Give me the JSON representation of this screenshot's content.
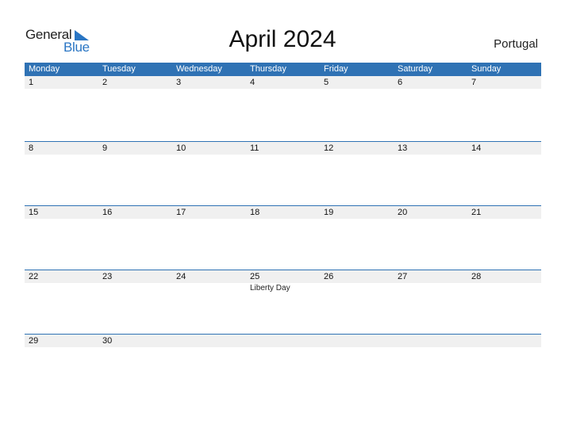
{
  "logo": {
    "word1": "General",
    "word2": "Blue",
    "icon": "triangle-flag-icon",
    "brand_color": "#2a76c4"
  },
  "title": "April 2024",
  "country": "Portugal",
  "colors": {
    "header_bg": "#2f72b4",
    "date_row_bg": "#f0f0f0"
  },
  "weekdays": [
    "Monday",
    "Tuesday",
    "Wednesday",
    "Thursday",
    "Friday",
    "Saturday",
    "Sunday"
  ],
  "weeks": [
    {
      "days": [
        "1",
        "2",
        "3",
        "4",
        "5",
        "6",
        "7"
      ],
      "events": [
        "",
        "",
        "",
        "",
        "",
        "",
        ""
      ]
    },
    {
      "days": [
        "8",
        "9",
        "10",
        "11",
        "12",
        "13",
        "14"
      ],
      "events": [
        "",
        "",
        "",
        "",
        "",
        "",
        ""
      ]
    },
    {
      "days": [
        "15",
        "16",
        "17",
        "18",
        "19",
        "20",
        "21"
      ],
      "events": [
        "",
        "",
        "",
        "",
        "",
        "",
        ""
      ]
    },
    {
      "days": [
        "22",
        "23",
        "24",
        "25",
        "26",
        "27",
        "28"
      ],
      "events": [
        "",
        "",
        "",
        "Liberty Day",
        "",
        "",
        ""
      ]
    },
    {
      "days": [
        "29",
        "30",
        "",
        "",
        "",
        "",
        ""
      ],
      "events": [
        "",
        "",
        "",
        "",
        "",
        "",
        ""
      ]
    }
  ]
}
